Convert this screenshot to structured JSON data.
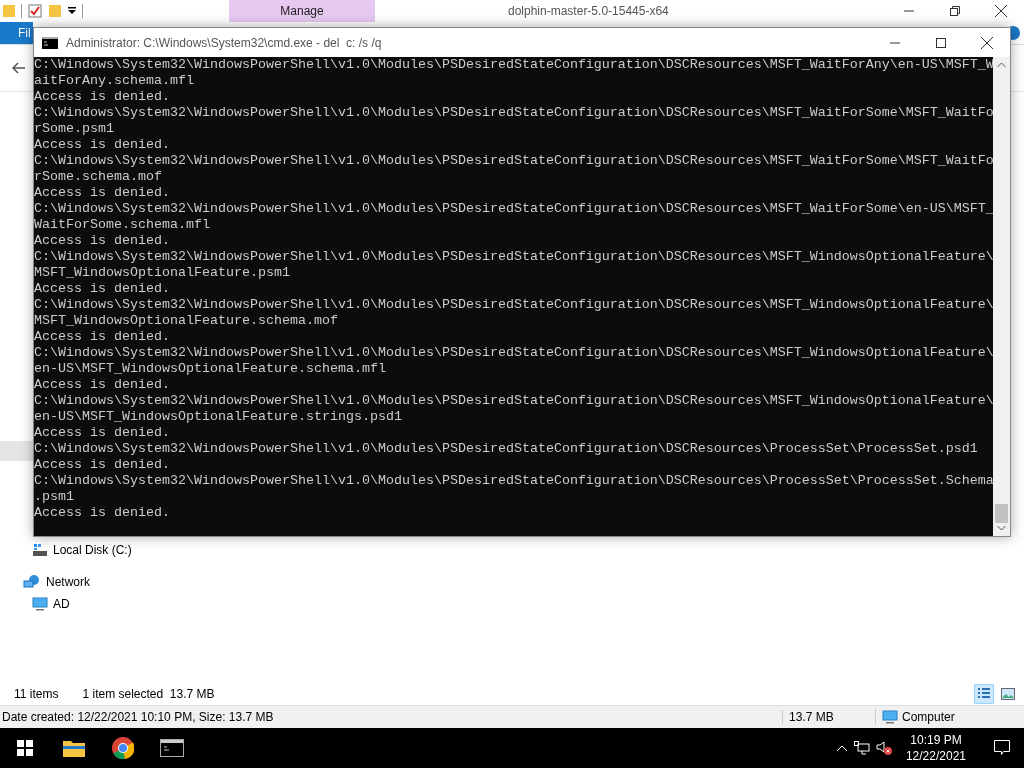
{
  "explorer": {
    "title": "dolphin-master-5.0-15445-x64",
    "manage_tab": "Manage",
    "file_tab": "Fil",
    "nav_items": [
      {
        "label": "Local Disk (C:)",
        "kind": "drive"
      },
      {
        "label": "Network",
        "kind": "network"
      },
      {
        "label": "AD",
        "kind": "computer"
      }
    ],
    "status": {
      "item_count": "11 items",
      "selection": "1 item selected  13.7 MB"
    },
    "view_buttons": [
      {
        "kind": "details",
        "selected": true
      },
      {
        "kind": "large",
        "selected": false
      }
    ],
    "details_bar": {
      "info": "Date created: 12/22/2021 10:10 PM, Size: 13.7 MB",
      "size": "13.7 MB",
      "location": "Computer"
    }
  },
  "console": {
    "title": "Administrator: C:\\Windows\\System32\\cmd.exe - del  c: /s /q",
    "lines": [
      "C:\\Windows\\System32\\WindowsPowerShell\\v1.0\\Modules\\PSDesiredStateConfiguration\\DSCResources\\MSFT_WaitForAny\\en-US\\MSFT_W",
      "aitForAny.schema.mfl",
      "Access is denied.",
      "C:\\Windows\\System32\\WindowsPowerShell\\v1.0\\Modules\\PSDesiredStateConfiguration\\DSCResources\\MSFT_WaitForSome\\MSFT_WaitFo",
      "rSome.psm1",
      "Access is denied.",
      "C:\\Windows\\System32\\WindowsPowerShell\\v1.0\\Modules\\PSDesiredStateConfiguration\\DSCResources\\MSFT_WaitForSome\\MSFT_WaitFo",
      "rSome.schema.mof",
      "Access is denied.",
      "C:\\Windows\\System32\\WindowsPowerShell\\v1.0\\Modules\\PSDesiredStateConfiguration\\DSCResources\\MSFT_WaitForSome\\en-US\\MSFT_",
      "WaitForSome.schema.mfl",
      "Access is denied.",
      "C:\\Windows\\System32\\WindowsPowerShell\\v1.0\\Modules\\PSDesiredStateConfiguration\\DSCResources\\MSFT_WindowsOptionalFeature\\",
      "MSFT_WindowsOptionalFeature.psm1",
      "Access is denied.",
      "C:\\Windows\\System32\\WindowsPowerShell\\v1.0\\Modules\\PSDesiredStateConfiguration\\DSCResources\\MSFT_WindowsOptionalFeature\\",
      "MSFT_WindowsOptionalFeature.schema.mof",
      "Access is denied.",
      "C:\\Windows\\System32\\WindowsPowerShell\\v1.0\\Modules\\PSDesiredStateConfiguration\\DSCResources\\MSFT_WindowsOptionalFeature\\",
      "en-US\\MSFT_WindowsOptionalFeature.schema.mfl",
      "Access is denied.",
      "C:\\Windows\\System32\\WindowsPowerShell\\v1.0\\Modules\\PSDesiredStateConfiguration\\DSCResources\\MSFT_WindowsOptionalFeature\\",
      "en-US\\MSFT_WindowsOptionalFeature.strings.psd1",
      "Access is denied.",
      "C:\\Windows\\System32\\WindowsPowerShell\\v1.0\\Modules\\PSDesiredStateConfiguration\\DSCResources\\ProcessSet\\ProcessSet.psd1",
      "Access is denied.",
      "C:\\Windows\\System32\\WindowsPowerShell\\v1.0\\Modules\\PSDesiredStateConfiguration\\DSCResources\\ProcessSet\\ProcessSet.Schema",
      ".psm1",
      "Access is denied."
    ]
  },
  "taskbar": {
    "time": "10:19 PM",
    "date": "12/22/2021"
  }
}
